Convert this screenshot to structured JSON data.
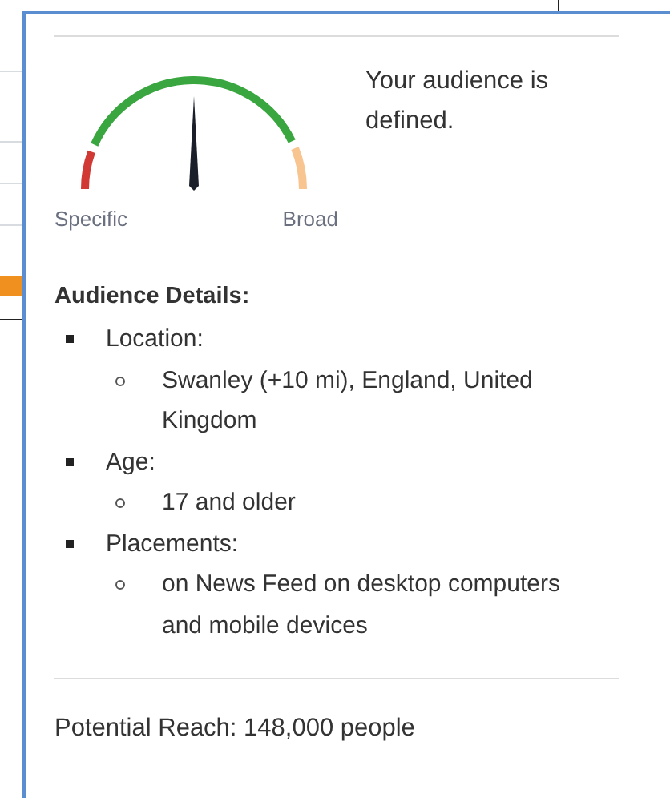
{
  "gauge": {
    "min_label": "Specific",
    "max_label": "Broad"
  },
  "status": "Your audience is defined.",
  "details": {
    "heading": "Audience Details:",
    "items": [
      {
        "label": "Location:",
        "children": [
          {
            "label": "Swanley (+10 mi), England, United Kingdom"
          }
        ]
      },
      {
        "label": "Age:",
        "children": [
          {
            "label": "17 and older"
          }
        ]
      },
      {
        "label": "Placements:",
        "children": [
          {
            "label": "on News Feed on desktop computers and mobile devices"
          }
        ]
      }
    ]
  },
  "reach": "Potential Reach: 148,000 people"
}
